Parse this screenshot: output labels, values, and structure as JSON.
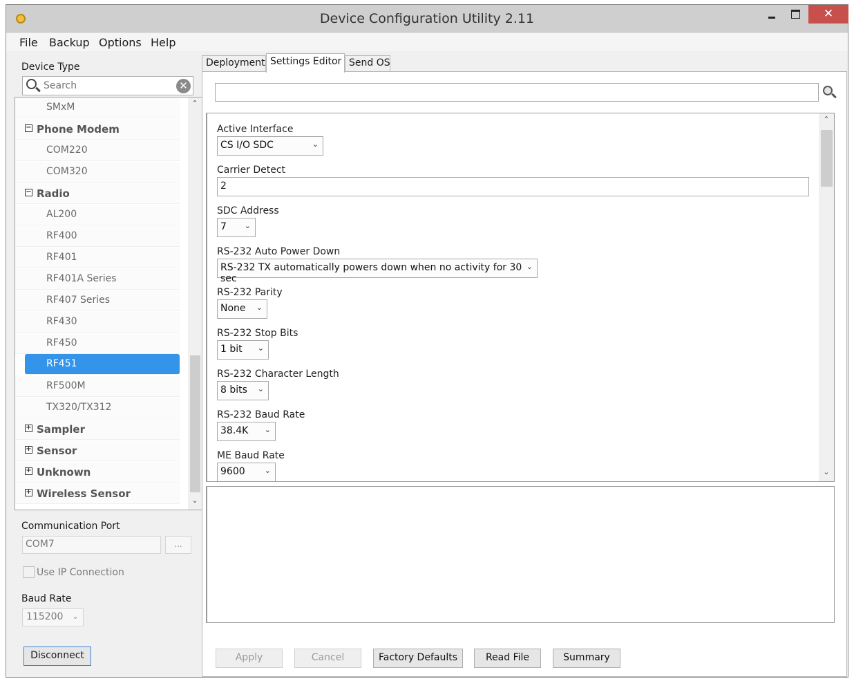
{
  "window": {
    "title": "Device Configuration Utility 2.11",
    "close_glyph": "✕",
    "icons": [
      "app-icon",
      "minimize-icon",
      "maximize-icon",
      "close-icon"
    ]
  },
  "menu": {
    "items": [
      "File",
      "Backup",
      "Options",
      "Help"
    ]
  },
  "device_type": {
    "label": "Device Type",
    "search_placeholder": "Search",
    "clear_glyph": "✕",
    "tree": [
      {
        "kind": "leaf",
        "label": "SMxM"
      },
      {
        "kind": "group",
        "label": "Phone Modem",
        "expander": "−"
      },
      {
        "kind": "leaf",
        "label": "COM220"
      },
      {
        "kind": "leaf",
        "label": "COM320"
      },
      {
        "kind": "group",
        "label": "Radio",
        "expander": "−"
      },
      {
        "kind": "leaf",
        "label": "AL200"
      },
      {
        "kind": "leaf",
        "label": "RF400"
      },
      {
        "kind": "leaf",
        "label": "RF401"
      },
      {
        "kind": "leaf",
        "label": "RF401A Series"
      },
      {
        "kind": "leaf",
        "label": "RF407 Series"
      },
      {
        "kind": "leaf",
        "label": "RF430"
      },
      {
        "kind": "leaf",
        "label": "RF450"
      },
      {
        "kind": "leaf",
        "label": "RF451",
        "selected": true
      },
      {
        "kind": "leaf",
        "label": "RF500M"
      },
      {
        "kind": "leaf",
        "label": "TX320/TX312"
      },
      {
        "kind": "group",
        "label": "Sampler",
        "expander": "+"
      },
      {
        "kind": "group",
        "label": "Sensor",
        "expander": "+"
      },
      {
        "kind": "group",
        "label": "Unknown",
        "expander": "+"
      },
      {
        "kind": "group",
        "label": "Wireless Sensor",
        "expander": "+"
      }
    ],
    "scroll_up_glyph": "⌃",
    "scroll_down_glyph": "⌄"
  },
  "communication": {
    "port_label": "Communication Port",
    "port_value": "COM7",
    "browse_label": "...",
    "use_ip_label": "Use IP Connection",
    "use_ip_checked": false,
    "baud_label": "Baud Rate",
    "baud_value": "115200",
    "disconnect_label": "Disconnect"
  },
  "tabs": [
    {
      "label": "Deployment",
      "active": false
    },
    {
      "label": "Settings Editor",
      "active": true
    },
    {
      "label": "Send OS",
      "active": false
    }
  ],
  "settings_editor": {
    "filter_value": "",
    "settings": [
      {
        "label": "Active Interface",
        "type": "dropdown",
        "value": "CS I/O SDC"
      },
      {
        "label": "Carrier Detect",
        "type": "text",
        "value": "2"
      },
      {
        "label": "SDC Address",
        "type": "dropdown",
        "value": "7"
      },
      {
        "label": "RS-232 Auto Power Down",
        "type": "dropdown",
        "value": "RS-232 TX automatically powers down when no activity for 30 sec"
      },
      {
        "label": "RS-232 Parity",
        "type": "dropdown",
        "value": "None"
      },
      {
        "label": "RS-232 Stop Bits",
        "type": "dropdown",
        "value": "1 bit"
      },
      {
        "label": "RS-232 Character Length",
        "type": "dropdown",
        "value": "8 bits"
      },
      {
        "label": "RS-232 Baud Rate",
        "type": "dropdown",
        "value": "38.4K"
      },
      {
        "label": "ME Baud Rate",
        "type": "dropdown",
        "value": "9600"
      }
    ],
    "chevron_glyph": "⌄",
    "scroll_up_glyph": "⌃",
    "scroll_down_glyph": "⌄",
    "description": ""
  },
  "actions": {
    "apply": "Apply",
    "cancel": "Cancel",
    "factory_defaults": "Factory Defaults",
    "read_file": "Read File",
    "summary": "Summary"
  },
  "colors": {
    "selection": "#3394ea",
    "close_button": "#c7504c",
    "focus_border": "#3c7fd1"
  }
}
